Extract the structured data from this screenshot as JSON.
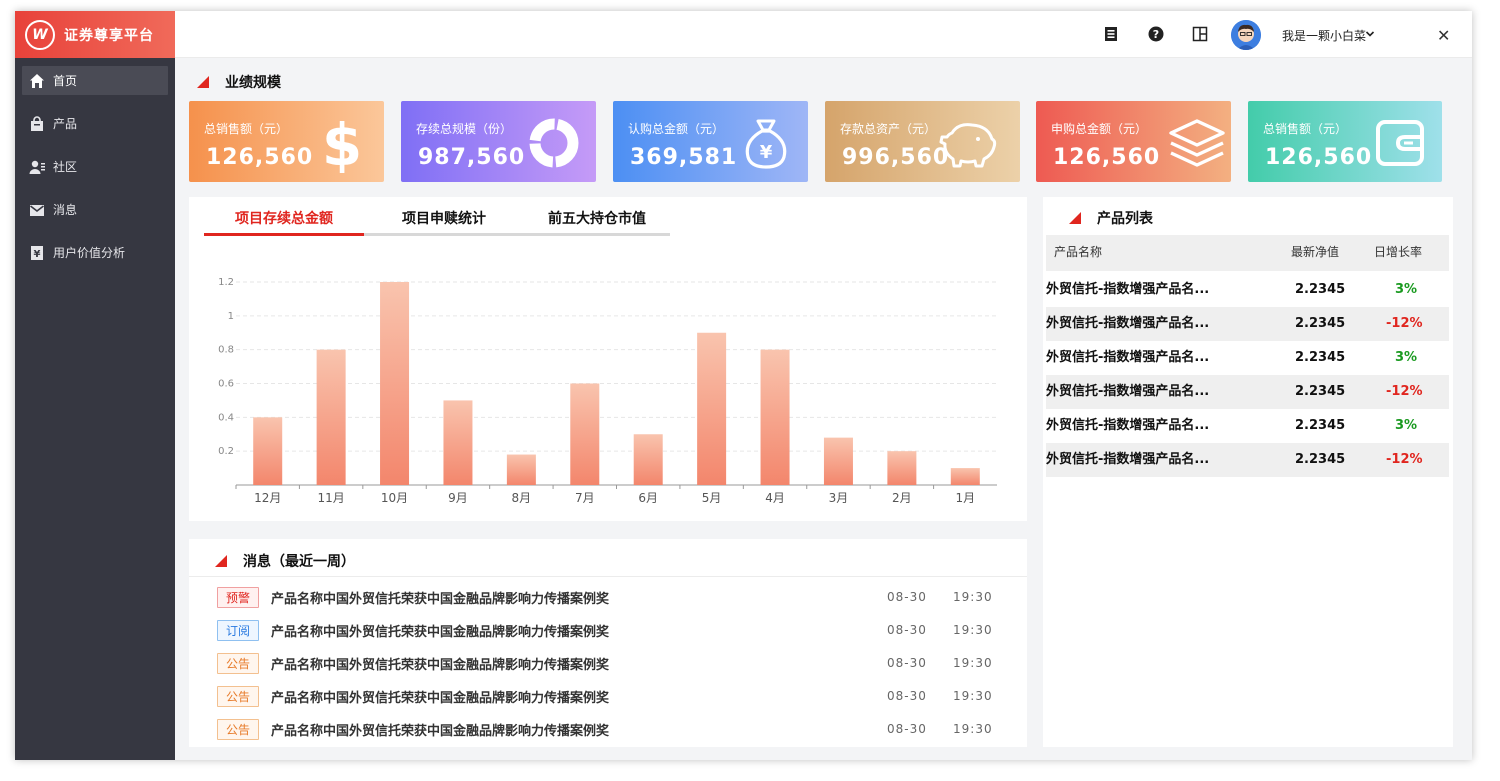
{
  "app": {
    "name": "证券尊享平台",
    "logo_glyph": "W"
  },
  "sidebar": {
    "items": [
      {
        "label": "首页",
        "icon": "home-icon",
        "active": true
      },
      {
        "label": "产品",
        "icon": "bag-icon",
        "active": false
      },
      {
        "label": "社区",
        "icon": "users-icon",
        "active": false
      },
      {
        "label": "消息",
        "icon": "mail-icon",
        "active": false
      },
      {
        "label": "用户价值分析",
        "icon": "yen-doc-icon",
        "active": false
      }
    ]
  },
  "topbar": {
    "icons": [
      "document-icon",
      "help-icon",
      "layout-icon"
    ],
    "user_name": "我是一颗小白菜",
    "close_glyph": "✕"
  },
  "performance": {
    "title": "业绩规模",
    "cards": [
      {
        "label": "总销售额（元）",
        "value": "126,560",
        "icon": "dollar-icon",
        "from": "#f5914c",
        "to": "#fbc79a"
      },
      {
        "label": "存续总规模（份）",
        "value": "987,560",
        "icon": "donut-icon",
        "from": "#7f6ff5",
        "to": "#c59bf7"
      },
      {
        "label": "认购总金额（元）",
        "value": "369,581",
        "icon": "money-bag-icon",
        "from": "#4c8ff3",
        "to": "#9fb6f6"
      },
      {
        "label": "存款总资产（元）",
        "value": "996,560",
        "icon": "piggy-bank-icon",
        "from": "#d5a46b",
        "to": "#ecd1a9"
      },
      {
        "label": "申购总金额（元）",
        "value": "126,560",
        "icon": "layers-icon",
        "from": "#ee5a52",
        "to": "#f3b081"
      },
      {
        "label": "总销售额（元）",
        "value": "126,560",
        "icon": "wallet-icon",
        "from": "#43ccaa",
        "to": "#9fe0ea"
      }
    ]
  },
  "chart_panel": {
    "tabs": [
      {
        "label": "项目存续总金额",
        "active": true
      },
      {
        "label": "项目申赎统计",
        "active": false
      },
      {
        "label": "前五大持仓市值",
        "active": false
      }
    ]
  },
  "chart_data": {
    "type": "bar",
    "categories": [
      "12月",
      "11月",
      "10月",
      "9月",
      "8月",
      "7月",
      "6月",
      "5月",
      "4月",
      "3月",
      "2月",
      "1月"
    ],
    "values": [
      0.4,
      0.8,
      1.2,
      0.5,
      0.18,
      0.6,
      0.3,
      0.9,
      0.8,
      0.28,
      0.2,
      0.1
    ],
    "yticks": [
      "0.2",
      "0.4",
      "0.6",
      "0.8",
      "1",
      "1.2"
    ],
    "ylim": [
      0,
      1.2
    ],
    "grid": true,
    "bar_color_top": "#f9c4ae",
    "bar_color_bottom": "#f3866c"
  },
  "messages": {
    "title": "消息（最近一周）",
    "items": [
      {
        "tag": "预警",
        "type": "warn",
        "text": "产品名称中国外贸信托荣获中国金融品牌影响力传播案例奖",
        "date": "08-30",
        "time": "19:30"
      },
      {
        "tag": "订阅",
        "type": "sub",
        "text": "产品名称中国外贸信托荣获中国金融品牌影响力传播案例奖",
        "date": "08-30",
        "time": "19:30"
      },
      {
        "tag": "公告",
        "type": "notice",
        "text": "产品名称中国外贸信托荣获中国金融品牌影响力传播案例奖",
        "date": "08-30",
        "time": "19:30"
      },
      {
        "tag": "公告",
        "type": "notice",
        "text": "产品名称中国外贸信托荣获中国金融品牌影响力传播案例奖",
        "date": "08-30",
        "time": "19:30"
      },
      {
        "tag": "公告",
        "type": "notice",
        "text": "产品名称中国外贸信托荣获中国金融品牌影响力传播案例奖",
        "date": "08-30",
        "time": "19:30"
      }
    ]
  },
  "products": {
    "title": "产品列表",
    "columns": [
      "产品名称",
      "最新净值",
      "日增长率"
    ],
    "rows": [
      {
        "name": "外贸信托-指数增强产品名...",
        "nav": "2.2345",
        "growth": "3%",
        "trend": "up"
      },
      {
        "name": "外贸信托-指数增强产品名...",
        "nav": "2.2345",
        "growth": "-12%",
        "trend": "down"
      },
      {
        "name": "外贸信托-指数增强产品名...",
        "nav": "2.2345",
        "growth": "3%",
        "trend": "up"
      },
      {
        "name": "外贸信托-指数增强产品名...",
        "nav": "2.2345",
        "growth": "-12%",
        "trend": "down"
      },
      {
        "name": "外贸信托-指数增强产品名...",
        "nav": "2.2345",
        "growth": "3%",
        "trend": "up"
      },
      {
        "name": "外贸信托-指数增强产品名...",
        "nav": "2.2345",
        "growth": "-12%",
        "trend": "down"
      }
    ]
  }
}
